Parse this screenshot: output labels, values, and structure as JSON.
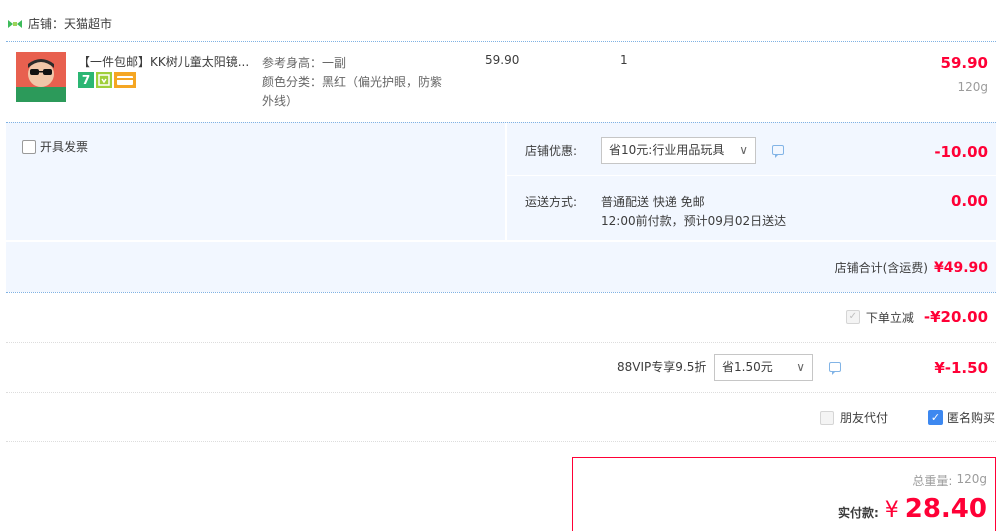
{
  "shop": {
    "label": "店铺：天猫超市"
  },
  "item": {
    "title": "【一件包邮】KK树儿童太阳镜...",
    "spec_height": "参考身高：一副",
    "spec_color": "颜色分类：黑红（偏光护眼，防紫外线）",
    "unit_price": "59.90",
    "quantity": "1",
    "subtotal": "59.90",
    "weight": "120g",
    "badges": [
      "seven-day-return-icon",
      "gold-badge-icon",
      "card-pay-icon"
    ]
  },
  "invoice": {
    "label": "开具发票"
  },
  "shop_discount": {
    "label": "店铺优惠:",
    "selected": "省10元:行业用品玩具",
    "amount": "-10.00"
  },
  "shipping": {
    "label": "运送方式:",
    "method": "普通配送 快递 免邮",
    "eta": "12:00前付款，预计09月02日送达",
    "amount": "0.00"
  },
  "shop_total": {
    "label": "店铺合计(含运费)",
    "amount": "¥49.90"
  },
  "instant_discount": {
    "label": "下单立减",
    "amount": "-¥20.00"
  },
  "vip": {
    "label": "88VIP专享9.5折",
    "selected": "省1.50元",
    "amount": "¥-1.50"
  },
  "options": {
    "friend_pay": "朋友代付",
    "anonymous": "匿名购买"
  },
  "summary": {
    "weight_label": "总重量:",
    "weight": "120g",
    "pay_label": "实付款:",
    "currency": "¥",
    "total": "28.40"
  },
  "colors": {
    "accent_red": "#ff0036",
    "border_blue": "#80b2e3",
    "panel_bg": "#f2f7ff",
    "checkbox_blue": "#3d88f0"
  }
}
